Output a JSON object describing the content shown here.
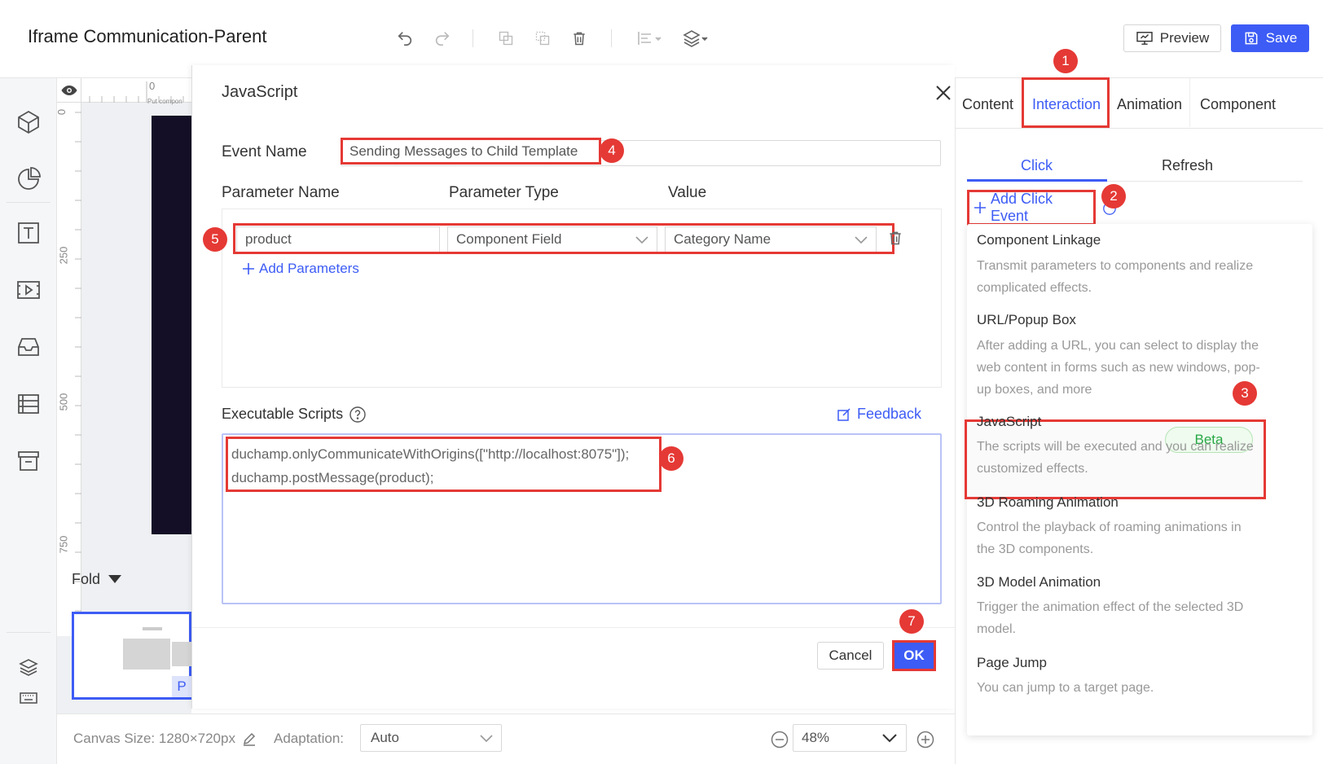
{
  "app": {
    "title": "Iframe Communication-Parent"
  },
  "toolbar": {
    "preview_label": "Preview",
    "save_label": "Save"
  },
  "canvas": {
    "ruler_top_label": "0",
    "ruler_hint": "Put compon",
    "ruler_left_labels": [
      "0",
      "250",
      "500",
      "750"
    ],
    "fold_label": "Fold",
    "thumb_tag": "P"
  },
  "modal": {
    "title": "JavaScript",
    "event_name_label": "Event Name",
    "event_name_value": "Sending Messages to Child Template",
    "columns": [
      "Parameter Name",
      "Parameter Type",
      "Value"
    ],
    "param": {
      "name": "product",
      "type": "Component Field",
      "value": "Category Name"
    },
    "add_params_label": "Add Parameters",
    "scripts_label": "Executable Scripts",
    "feedback_label": "Feedback",
    "script_lines": [
      "duchamp.onlyCommunicateWithOrigins([\"http://localhost:8075\"]);",
      "duchamp.postMessage(product);"
    ],
    "cancel_label": "Cancel",
    "ok_label": "OK"
  },
  "right_panel": {
    "tabs": [
      "Content",
      "Interaction",
      "Animation",
      "Component"
    ],
    "active_tab": "Interaction",
    "subtabs": [
      "Click",
      "Refresh"
    ],
    "add_click_label": "Add Click Event",
    "menu": [
      {
        "title": "Component Linkage",
        "desc": "Transmit parameters to components and realize complicated effects."
      },
      {
        "title": "URL/Popup Box",
        "desc": "After adding a URL, you can select to display the web content in forms such as new windows, pop-up boxes, and more"
      },
      {
        "title": "JavaScript",
        "desc": "The scripts will be executed and you can realize customized effects.",
        "badge": "Beta"
      },
      {
        "title": "3D Roaming Animation",
        "desc": "Control the playback of roaming animations in the 3D components."
      },
      {
        "title": "3D Model Animation",
        "desc": "Trigger the animation effect of the selected 3D model."
      },
      {
        "title": "Page Jump",
        "desc": "You can jump to a target page."
      }
    ]
  },
  "bottom": {
    "canvas_size": "Canvas Size: 1280×720px",
    "adaptation_label": "Adaptation:",
    "adaptation_value": "Auto",
    "zoom": "48%"
  },
  "badges": [
    "1",
    "2",
    "3",
    "4",
    "5",
    "6",
    "7"
  ],
  "colors": {
    "accent": "#3d5cf5",
    "highlight": "#e53935",
    "canvas_dark": "#140f26",
    "beta": "#28a745"
  }
}
